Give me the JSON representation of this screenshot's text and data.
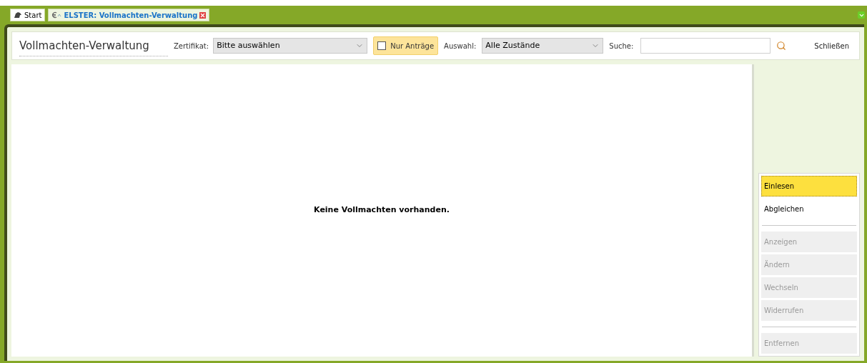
{
  "tabs": [
    {
      "label": "Start",
      "selected": false,
      "kind": "home"
    },
    {
      "label": "ELSTER: Vollmachten-Verwaltung",
      "selected": true,
      "kind": "module",
      "closable": true
    }
  ],
  "toolbar": {
    "title": "Vollmachten-Verwaltung",
    "certificate_label": "Zertifikat:",
    "certificate_value": "Bitte auswählen",
    "only_requests": {
      "label": "Nur Anträge",
      "checked": false
    },
    "selection_label": "Auswahl:",
    "selection_value": "Alle Zustände",
    "search_label": "Suche:",
    "close": "Schließen"
  },
  "empty_message": "Keine Vollmachten vorhanden.",
  "actions": [
    {
      "kind": "button",
      "label": "Einlesen",
      "selected": true,
      "disabled": false
    },
    {
      "kind": "button",
      "label": "Abgleichen",
      "selected": false,
      "disabled": false
    },
    {
      "kind": "divider"
    },
    {
      "kind": "button",
      "label": "Anzeigen",
      "selected": false,
      "disabled": true
    },
    {
      "kind": "button",
      "label": "Ändern",
      "selected": false,
      "disabled": true
    },
    {
      "kind": "button",
      "label": "Wechseln",
      "selected": false,
      "disabled": true
    },
    {
      "kind": "button",
      "label": "Widerrufen",
      "selected": false,
      "disabled": true
    },
    {
      "kind": "divider"
    },
    {
      "kind": "button",
      "label": "Entfernen",
      "selected": false,
      "disabled": true
    }
  ]
}
